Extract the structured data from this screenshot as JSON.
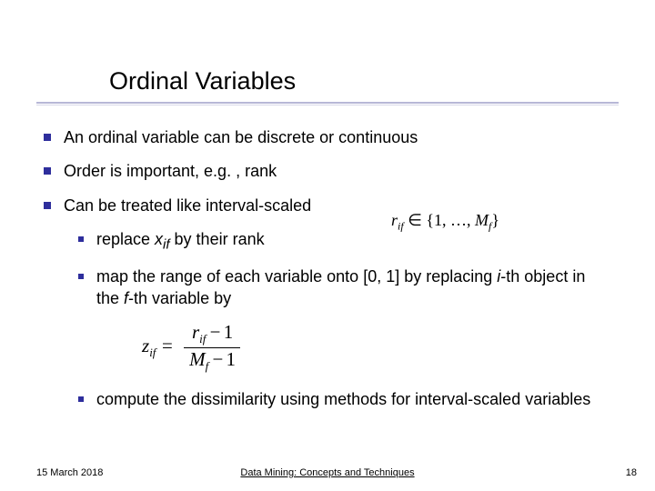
{
  "title": "Ordinal Variables",
  "bullets": {
    "b1": "An ordinal variable can be discrete or continuous",
    "b2": "Order is important, e.g. , rank",
    "b3": "Can be treated like interval-scaled"
  },
  "sub": {
    "s1_pre": "replace ",
    "s1_var_x": "x",
    "s1_var_sub": "if",
    "s1_post": " by their rank",
    "s2_a": "map the range of each variable onto [0, 1] by replacing ",
    "s2_i": "i",
    "s2_b": "-th object in the ",
    "s2_f": "f",
    "s2_c": "-th variable by",
    "s3": "compute the dissimilarity using methods for interval-scaled variables"
  },
  "math": {
    "r": "r",
    "r_sub": "if",
    "in": " ∈ {1, …, ",
    "M": "M",
    "M_sub": "f",
    "close": "}",
    "z": "z",
    "z_sub": "if",
    "eq": " = ",
    "num_a": "r",
    "num_sub": "if",
    "num_b": " − 1",
    "den_a": "M",
    "den_sub": "f",
    "den_b": " − 1"
  },
  "footer": {
    "date": "15 March 2018",
    "center": "Data Mining: Concepts and Techniques",
    "page": "18"
  }
}
